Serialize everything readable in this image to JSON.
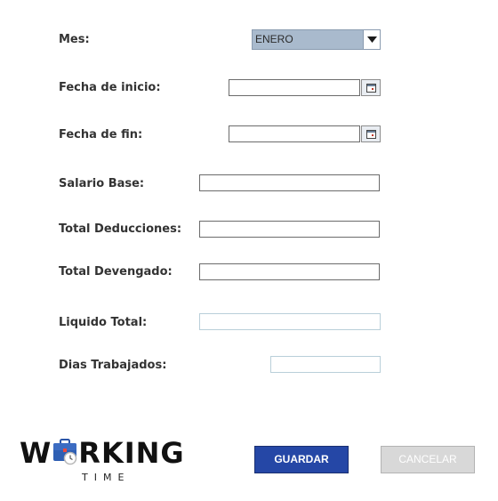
{
  "form": {
    "month_label": "Mes:",
    "month_value": "ENERO",
    "start_date_label": "Fecha de inicio:",
    "start_date_value": "",
    "end_date_label": "Fecha de fin:",
    "end_date_value": "",
    "base_salary_label": "Salario Base:",
    "base_salary_value": "",
    "total_deductions_label": "Total Deducciones:",
    "total_deductions_value": "",
    "total_accrued_label": "Total Devengado:",
    "total_accrued_value": "",
    "net_total_label": "Liquido Total:",
    "net_total_value": "",
    "days_worked_label": "Dias Trabajados:",
    "days_worked_value": ""
  },
  "buttons": {
    "save_label": "GUARDAR",
    "cancel_label": "CANCELAR"
  },
  "logo": {
    "word_prefix": "W",
    "word_suffix": "RKING",
    "subtitle": "TIME"
  },
  "icons": {
    "dropdown": "chevron-down-icon",
    "date_picker": "calendar-icon",
    "logo_mark": "briefcase-clock-icon"
  },
  "colors": {
    "primary_button": "#2547a6",
    "disabled_button": "#d8d8d8",
    "combo_fill": "#a9bacd",
    "label_text": "#333333"
  }
}
